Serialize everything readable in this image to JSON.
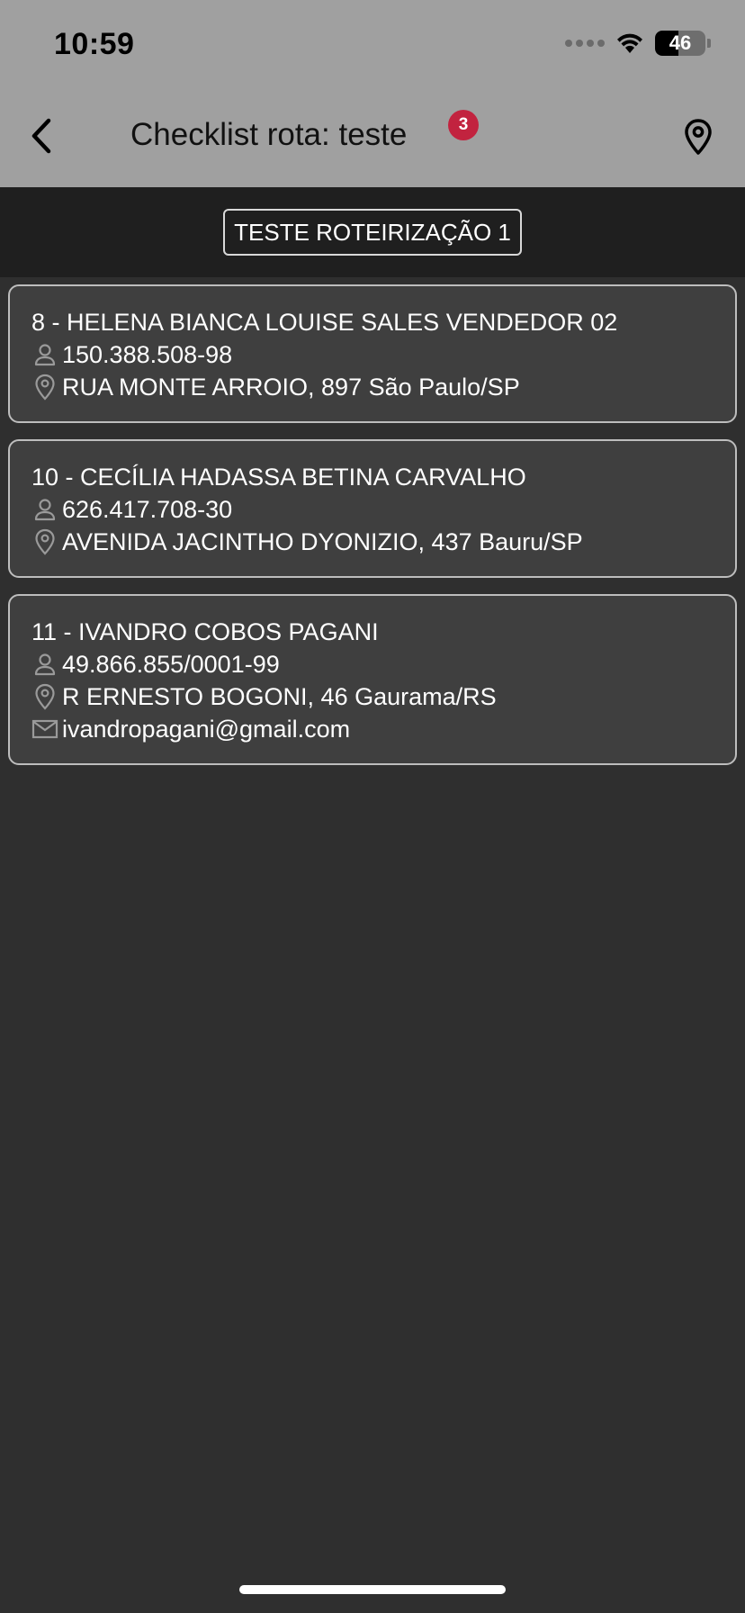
{
  "status_bar": {
    "time": "10:59",
    "battery": "46",
    "battery_level": 0.46
  },
  "app_bar": {
    "title": "Checklist rota: teste",
    "badge_count": "3",
    "badge_color": "#c2233f"
  },
  "route_filter": {
    "label": "TESTE ROTEIRIZAÇÃO 1"
  },
  "clients": [
    {
      "title": "8 - HELENA BIANCA LOUISE SALES VENDEDOR 02",
      "document": "150.388.508-98",
      "address": "RUA MONTE ARROIO, 897 São Paulo/SP"
    },
    {
      "title": "10 - CECÍLIA HADASSA BETINA CARVALHO",
      "document": "626.417.708-30",
      "address": "AVENIDA JACINTHO DYONIZIO, 437 Bauru/SP"
    },
    {
      "title": "11 - IVANDRO COBOS PAGANI",
      "document": "49.866.855/0001-99",
      "address": "R ERNESTO BOGONI, 46 Gaurama/RS",
      "email": "ivandropagani@gmail.com"
    }
  ],
  "icons": {
    "back": "chevron-left-icon",
    "map": "map-pin-icon",
    "person": "person-icon",
    "location": "location-pin-icon",
    "email": "envelope-icon"
  }
}
